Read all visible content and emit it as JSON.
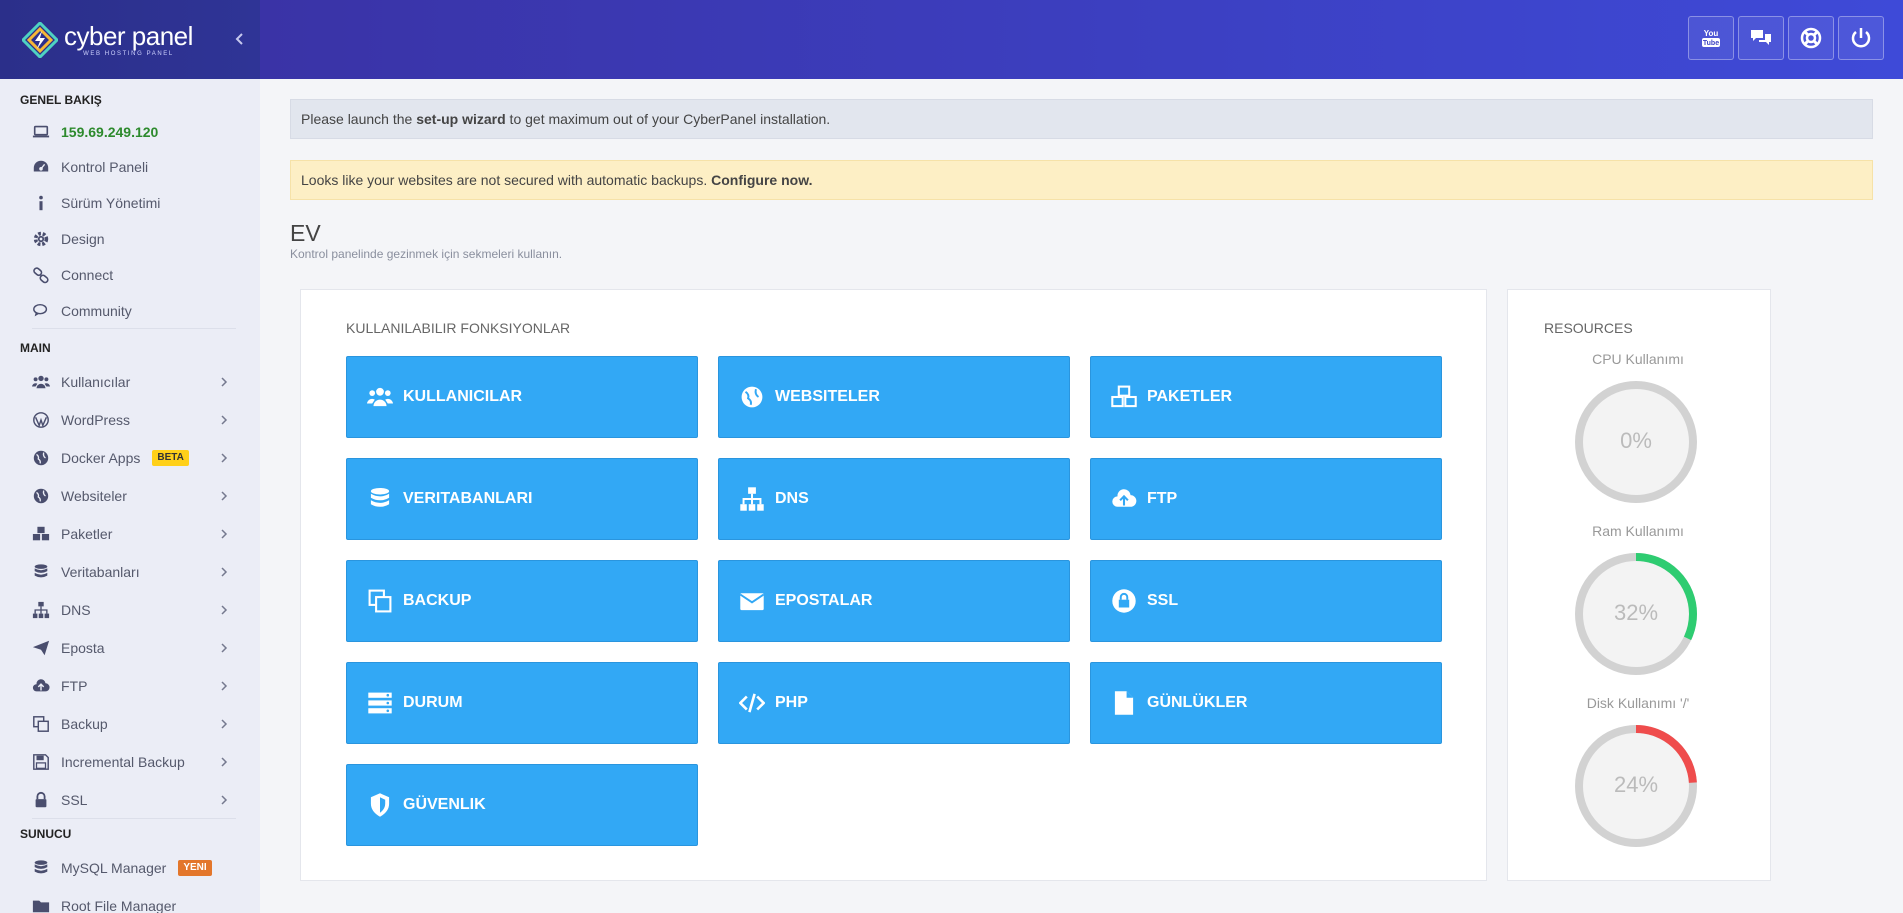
{
  "brand": {
    "name": "cyber panel",
    "tagline": "WEB HOSTING PANEL"
  },
  "sidebar": {
    "section_overview": "GENEL BAKIŞ",
    "overview_items": [
      {
        "label": "159.69.249.120",
        "icon": "laptop-icon"
      },
      {
        "label": "Kontrol Paneli",
        "icon": "dashboard-icon"
      },
      {
        "label": "Sürüm Yönetimi",
        "icon": "info-icon"
      },
      {
        "label": "Design",
        "icon": "gear-icon"
      },
      {
        "label": "Connect",
        "icon": "link-icon"
      },
      {
        "label": "Community",
        "icon": "chat-icon"
      }
    ],
    "section_main": "MAIN",
    "main_items": [
      {
        "label": "Kullanıcılar",
        "icon": "users-icon"
      },
      {
        "label": "WordPress",
        "icon": "wordpress-icon"
      },
      {
        "label": "Docker Apps",
        "icon": "globe-icon",
        "badge": "BETA"
      },
      {
        "label": "Websiteler",
        "icon": "globe-icon"
      },
      {
        "label": "Paketler",
        "icon": "cubes-icon"
      },
      {
        "label": "Veritabanları",
        "icon": "database-icon"
      },
      {
        "label": "DNS",
        "icon": "sitemap-icon"
      },
      {
        "label": "Eposta",
        "icon": "paper-plane-icon"
      },
      {
        "label": "FTP",
        "icon": "cloud-upload-icon"
      },
      {
        "label": "Backup",
        "icon": "copy-icon"
      },
      {
        "label": "Incremental Backup",
        "icon": "save-icon"
      },
      {
        "label": "SSL",
        "icon": "lock-icon"
      }
    ],
    "section_server": "SUNUCU",
    "server_items": [
      {
        "label": "MySQL Manager",
        "icon": "database-icon",
        "badge": "YENI"
      },
      {
        "label": "Root File Manager",
        "icon": "folder-icon"
      }
    ]
  },
  "header_buttons": [
    {
      "name": "youtube-button",
      "icon": "youtube-icon"
    },
    {
      "name": "chat-button",
      "icon": "chat-icon"
    },
    {
      "name": "support-button",
      "icon": "lifebuoy-icon"
    },
    {
      "name": "logout-button",
      "icon": "power-icon"
    }
  ],
  "alerts": {
    "wizard": {
      "before": "Please launch the ",
      "link": "set-up wizard",
      "after": " to get maximum out of your CyberPanel installation."
    },
    "backup": {
      "before": "Looks like your websites are not secured with automatic backups. ",
      "link": "Configure now."
    }
  },
  "page": {
    "title": "EV",
    "subtitle": "Kontrol panelinde gezinmek için sekmeleri kullanın."
  },
  "functions": {
    "title": "KULLANILABILIR FONKSIYONLAR",
    "tiles": [
      {
        "label": "KULLANICILAR",
        "icon": "users-icon"
      },
      {
        "label": "WEBSITELER",
        "icon": "globe-icon"
      },
      {
        "label": "PAKETLER",
        "icon": "cubes-icon"
      },
      {
        "label": "VERITABANLARI",
        "icon": "database-icon"
      },
      {
        "label": "DNS",
        "icon": "sitemap-icon"
      },
      {
        "label": "FTP",
        "icon": "cloud-upload-icon"
      },
      {
        "label": "BACKUP",
        "icon": "copy-icon"
      },
      {
        "label": "EPOSTALAR",
        "icon": "envelope-icon"
      },
      {
        "label": "SSL",
        "icon": "lock-icon"
      },
      {
        "label": "DURUM",
        "icon": "server-icon"
      },
      {
        "label": "PHP",
        "icon": "code-icon"
      },
      {
        "label": "GÜNLÜKLER",
        "icon": "file-icon"
      },
      {
        "label": "GÜVENLIK",
        "icon": "shield-icon"
      }
    ]
  },
  "resources": {
    "title": "RESOURCES",
    "gauges": [
      {
        "label": "CPU Kullanımı",
        "value": "0%",
        "fraction": 0,
        "color": "#2ecc71"
      },
      {
        "label": "Ram Kullanımı",
        "value": "32%",
        "fraction": 0.32,
        "color": "#2ecc71"
      },
      {
        "label": "Disk Kullanımı '/'",
        "value": "24%",
        "fraction": 0.24,
        "color": "#ef4c4c"
      }
    ]
  },
  "colors": {
    "header": "#3a3fb8",
    "tile": "#32a8f5",
    "sidebar": "#ebedf6",
    "ip": "#2d8a2d",
    "beta_badge": "#ffd019",
    "new_badge": "#e3762b"
  }
}
